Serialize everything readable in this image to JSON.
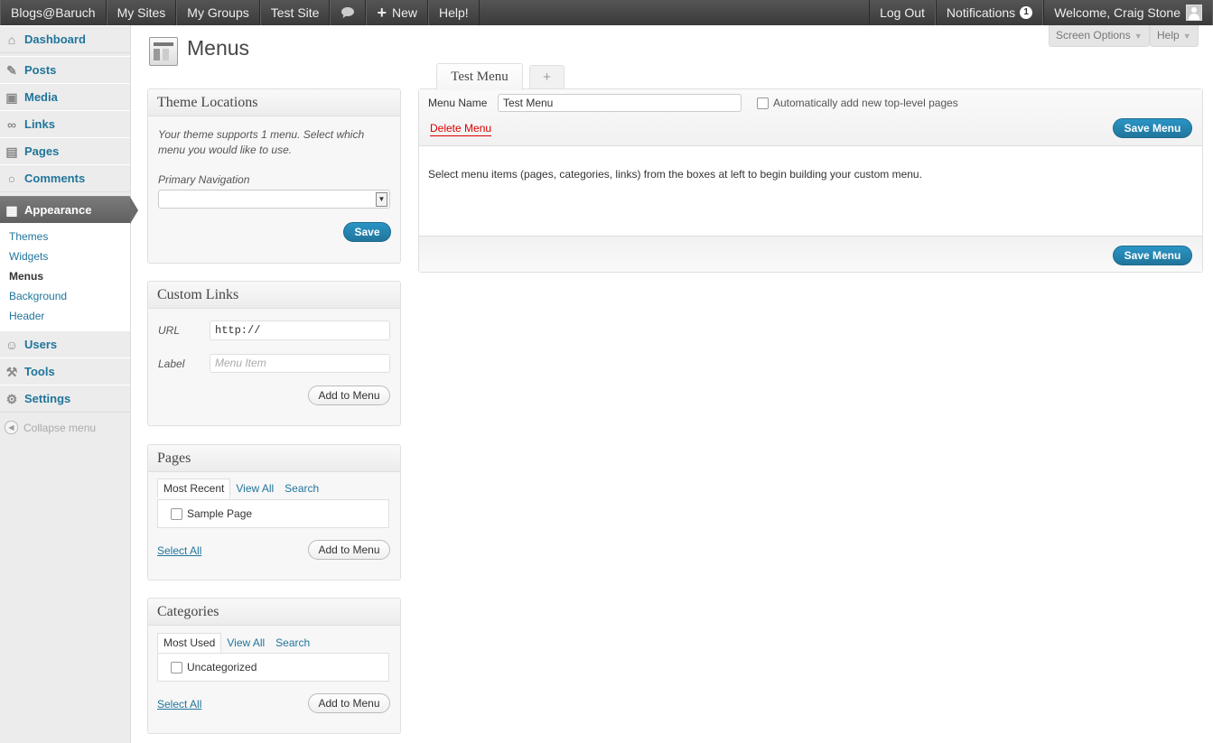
{
  "adminbar": {
    "site": "Blogs@Baruch",
    "my_sites": "My Sites",
    "my_groups": "My Groups",
    "test_site": "Test Site",
    "comments_icon": "speech-bubble-icon",
    "new_label": "New",
    "help": "Help!",
    "logout": "Log Out",
    "notifications": "Notifications",
    "notifications_count": "1",
    "welcome": "Welcome, Craig Stone"
  },
  "sidebar": {
    "items": [
      {
        "label": "Dashboard",
        "icon": "house-icon"
      },
      {
        "label": "Posts",
        "icon": "pin-icon"
      },
      {
        "label": "Media",
        "icon": "media-icon"
      },
      {
        "label": "Links",
        "icon": "link-icon"
      },
      {
        "label": "Pages",
        "icon": "pages-icon"
      },
      {
        "label": "Comments",
        "icon": "comment-icon"
      },
      {
        "label": "Appearance",
        "icon": "appearance-icon"
      },
      {
        "label": "Users",
        "icon": "users-icon"
      },
      {
        "label": "Tools",
        "icon": "tools-icon"
      },
      {
        "label": "Settings",
        "icon": "settings-icon"
      }
    ],
    "submenu": [
      "Themes",
      "Widgets",
      "Menus",
      "Background",
      "Header"
    ],
    "collapse": "Collapse menu"
  },
  "screen_options": "Screen Options",
  "help": "Help",
  "page_title": "Menus",
  "theme_locations": {
    "title": "Theme Locations",
    "description": "Your theme supports 1 menu. Select which menu you would like to use.",
    "primary_label": "Primary Navigation",
    "primary_value": "",
    "save": "Save"
  },
  "custom_links": {
    "title": "Custom Links",
    "url_label": "URL",
    "url_value": "http://",
    "label_label": "Label",
    "label_placeholder": "Menu Item",
    "add": "Add to Menu"
  },
  "pages_box": {
    "title": "Pages",
    "tabs": [
      "Most Recent",
      "View All",
      "Search"
    ],
    "item": "Sample Page",
    "select_all": "Select All",
    "add": "Add to Menu"
  },
  "categories_box": {
    "title": "Categories",
    "tabs": [
      "Most Used",
      "View All",
      "Search"
    ],
    "item": "Uncategorized",
    "select_all": "Select All",
    "add": "Add to Menu"
  },
  "menu_editor": {
    "tab_active": "Test Menu",
    "tab_add": "+",
    "name_label": "Menu Name",
    "name_value": "Test Menu",
    "auto_add": "Automatically add new top-level pages",
    "delete": "Delete Menu",
    "save": "Save Menu",
    "instructions": "Select menu items (pages, categories, links) from the boxes at left to begin building your custom menu."
  }
}
